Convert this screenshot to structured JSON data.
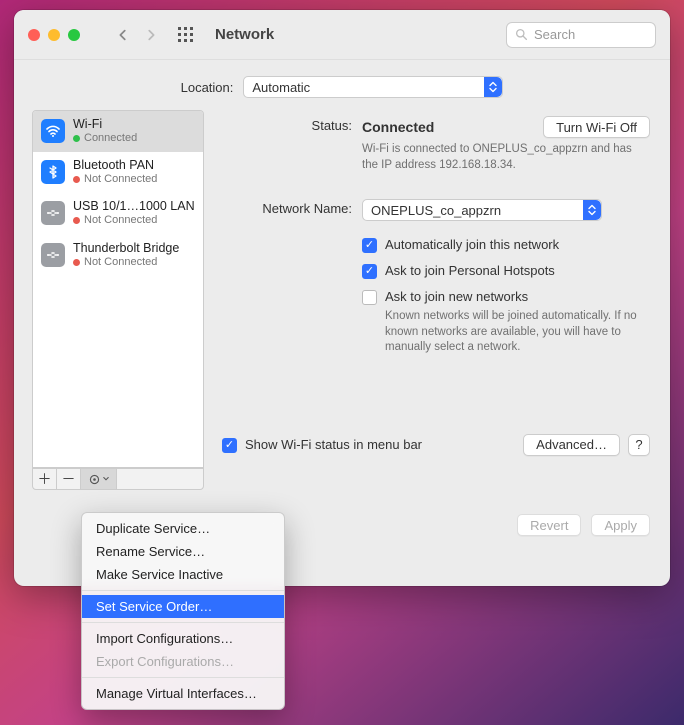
{
  "title": "Network",
  "search_placeholder": "Search",
  "location": {
    "label": "Location:",
    "value": "Automatic"
  },
  "services": [
    {
      "name": "Wi-Fi",
      "status": "Connected",
      "connected": true
    },
    {
      "name": "Bluetooth PAN",
      "status": "Not Connected",
      "connected": false
    },
    {
      "name": "USB 10/1…1000 LAN",
      "status": "Not Connected",
      "connected": false
    },
    {
      "name": "Thunderbolt Bridge",
      "status": "Not Connected",
      "connected": false
    }
  ],
  "panel": {
    "status_label": "Status:",
    "status_value": "Connected",
    "wifi_toggle": "Turn Wi-Fi Off",
    "status_desc": "Wi-Fi is connected to ONEPLUS_co_appzrn and has the IP address 192.168.18.34.",
    "network_name_label": "Network Name:",
    "network_name_value": "ONEPLUS_co_appzrn",
    "opt_auto_join": "Automatically join this network",
    "opt_ask_hotspot": "Ask to join Personal Hotspots",
    "opt_ask_new": "Ask to join new networks",
    "opt_ask_new_desc": "Known networks will be joined automatically. If no known networks are available, you will have to manually select a network.",
    "show_status": "Show Wi-Fi status in menu bar",
    "advanced": "Advanced…",
    "help": "?",
    "revert": "Revert",
    "apply": "Apply"
  },
  "menu": {
    "duplicate": "Duplicate Service…",
    "rename": "Rename Service…",
    "inactive": "Make Service Inactive",
    "order": "Set Service Order…",
    "import": "Import Configurations…",
    "export": "Export Configurations…",
    "manage": "Manage Virtual Interfaces…"
  }
}
